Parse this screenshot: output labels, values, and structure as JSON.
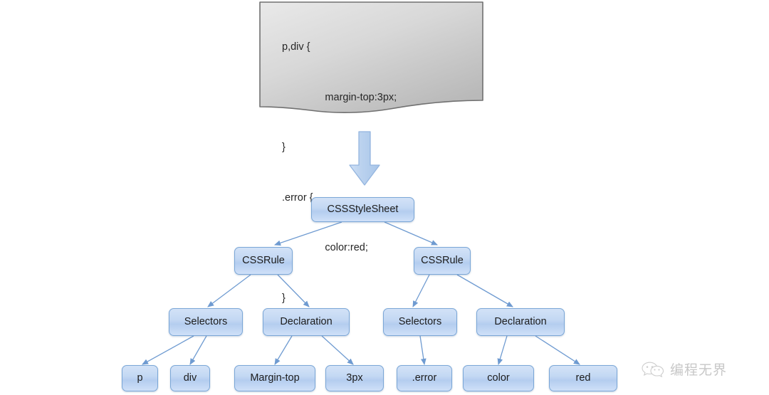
{
  "code_block": {
    "name": "css-source-paper",
    "lines": [
      "p,div {",
      "               margin-top:3px;",
      "}",
      ".error {",
      "               color:red;",
      "}"
    ]
  },
  "arrow": {
    "label": "downward-arrow"
  },
  "tree": {
    "root": {
      "label": "CSSStyleSheet"
    },
    "level2": [
      {
        "label": "CSSRule"
      },
      {
        "label": "CSSRule"
      }
    ],
    "level3": [
      {
        "label": "Selectors"
      },
      {
        "label": "Declaration"
      },
      {
        "label": "Selectors"
      },
      {
        "label": "Declaration"
      }
    ],
    "leaves": [
      {
        "label": "p"
      },
      {
        "label": "div"
      },
      {
        "label": "Margin-top"
      },
      {
        "label": "3px"
      },
      {
        "label": ".error"
      },
      {
        "label": "color"
      },
      {
        "label": "red"
      }
    ]
  },
  "watermark": {
    "icon": "wechat-icon",
    "text": "编程无界"
  },
  "colors": {
    "node_border": "#7ba7d7",
    "node_fill_top": "#d3e2f7",
    "node_fill_bottom": "#b4cdef",
    "connector": "#6f9bd1",
    "paper_fill": "#c9c9c9",
    "arrow_fill": "#bdd4ef"
  }
}
